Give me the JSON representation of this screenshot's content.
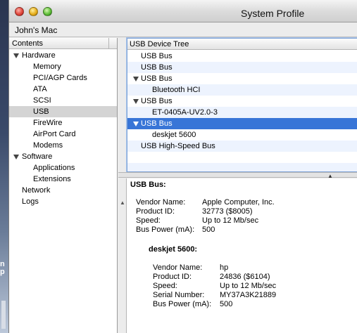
{
  "window": {
    "title": "System Profile",
    "machine_name": "John's Mac"
  },
  "sidebar": {
    "header": "Contents",
    "hardware_label": "Hardware",
    "hardware_items": [
      "Memory",
      "PCI/AGP Cards",
      "ATA",
      "SCSI",
      "USB",
      "FireWire",
      "AirPort Card",
      "Modems"
    ],
    "selected": "USB",
    "software_label": "Software",
    "software_items": [
      "Applications",
      "Extensions"
    ],
    "network_label": "Network",
    "logs_label": "Logs"
  },
  "device_tree": {
    "header": "USB Device Tree",
    "rows": [
      "USB Bus",
      "USB Bus",
      "USB Bus",
      "Bluetooth HCI",
      "USB Bus",
      "ET-0405A-UV2.0-3",
      "USB Bus",
      "deskjet 5600",
      "USB High-Speed Bus"
    ],
    "selected_index": 6
  },
  "details": {
    "bus_title": "USB Bus:",
    "bus": [
      {
        "key": "Vendor Name:",
        "value": "Apple Computer, Inc."
      },
      {
        "key": "Product ID:",
        "value": "32773 ($8005)"
      },
      {
        "key": "Speed:",
        "value": "Up to 12 Mb/sec"
      },
      {
        "key": "Bus Power (mA):",
        "value": "500"
      }
    ],
    "device_title": "deskjet 5600:",
    "device": [
      {
        "key": "Vendor Name:",
        "value": "hp"
      },
      {
        "key": "Product ID:",
        "value": "24836 ($6104)"
      },
      {
        "key": "Speed:",
        "value": "Up to 12 Mb/sec"
      },
      {
        "key": "Serial Number:",
        "value": "MY37A3K21889"
      },
      {
        "key": "Bus Power (mA):",
        "value": "500"
      }
    ]
  },
  "desktop_glyphs": [
    "n",
    "p"
  ],
  "colors": {
    "selection": "#3875d7",
    "sidebar_selection": "#d4d4d4"
  }
}
